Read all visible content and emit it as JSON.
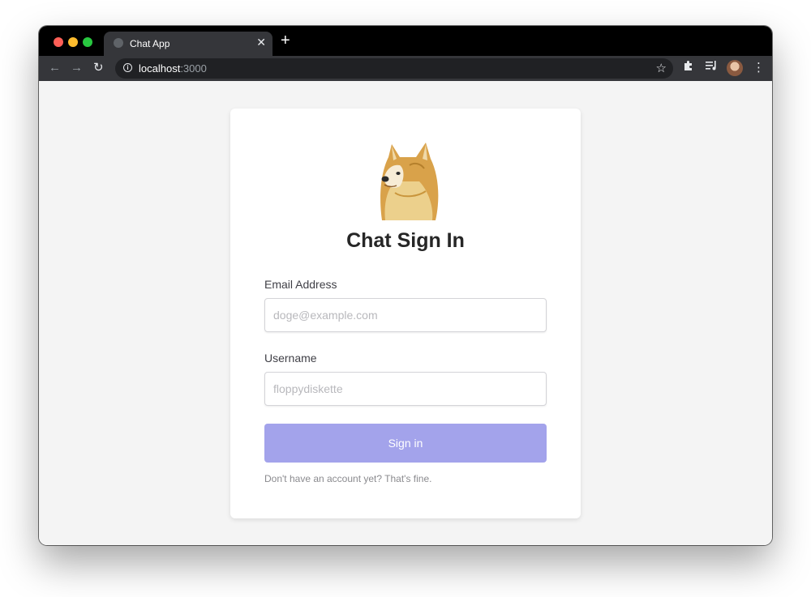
{
  "browser": {
    "tab_title": "Chat App",
    "tab_close": "✕",
    "new_tab": "+",
    "url_host": "localhost",
    "url_port": ":3000",
    "icons": {
      "back": "arrow-left-icon",
      "forward": "arrow-right-icon",
      "reload": "reload-icon",
      "info": "info-icon",
      "bookmark": "star-icon",
      "extensions": "puzzle-icon",
      "media": "media-queue-icon",
      "menu": "kebab-menu-icon"
    },
    "colors": {
      "tabstrip": "#000000",
      "toolbar": "#35363a",
      "omnibox": "#202124"
    }
  },
  "form": {
    "title": "Chat Sign In",
    "email_label": "Email Address",
    "email_placeholder": "doge@example.com",
    "email_value": "",
    "username_label": "Username",
    "username_placeholder": "floppydiskette",
    "username_value": "",
    "submit_label": "Sign in",
    "footer_text": "Don't have an account yet? That's fine.",
    "logo_icon": "doge-logo",
    "colors": {
      "button": "#a3a3eb",
      "page_bg": "#f4f4f4",
      "card_bg": "#ffffff"
    }
  }
}
